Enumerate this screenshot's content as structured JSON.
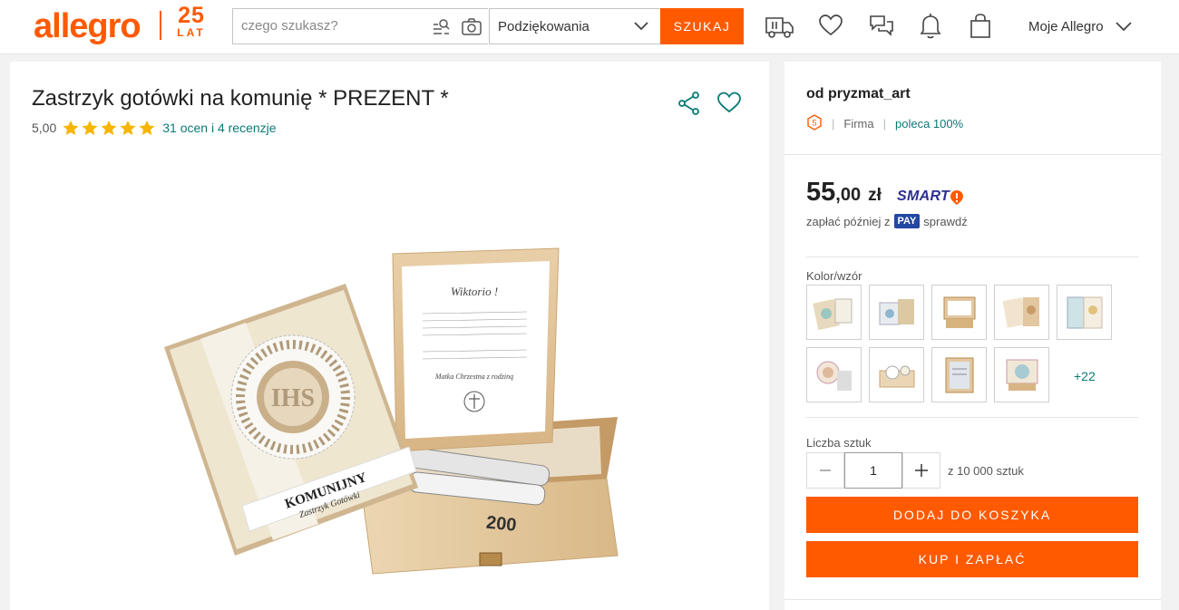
{
  "header": {
    "logo_text": "allegro",
    "anniversary_number": "25",
    "anniversary_word": "LAT",
    "search_placeholder": "czego szukasz?",
    "category": "Podziękowania",
    "search_button": "SZUKAJ",
    "account_label": "Moje Allegro",
    "icons": [
      "delivery-truck-icon",
      "heart-icon",
      "chat-icon",
      "bell-icon",
      "shopping-bag-icon"
    ]
  },
  "product": {
    "title": "Zastrzyk gotówki na komunię * PREZENT *",
    "rating_value": "5,00",
    "stars": 5,
    "rating_count": "31 ocen i 4 recenzje",
    "image_card_title": "Wiktorio !",
    "image_card_signature": "Matka Chrzestna z rodziną",
    "image_box_label": "KOMUNIJNY",
    "image_box_sublabel": "Zastrzyk Gotówki",
    "image_banknote": "200"
  },
  "seller": {
    "name": "od pryzmat_art",
    "type": "Firma",
    "recommend": "poleca 100%"
  },
  "offer": {
    "price_int": "55",
    "price_dec": ",00",
    "currency": "zł",
    "smart_label": "SMART",
    "paylater_prefix": "zapłać później z",
    "pay_badge": "PAY",
    "paylater_link": "sprawdź",
    "color_label": "Kolor/wzór",
    "more_variants": "+22",
    "qty_label": "Liczba sztuk",
    "qty_value": "1",
    "qty_available": "z 10 000 sztuk",
    "add_to_cart": "DODAJ DO KOSZYKA",
    "buy_now": "KUP I ZAPŁAĆ"
  },
  "colors": {
    "brand": "#ff5a00",
    "link": "#0b7a75",
    "star": "#f7b500",
    "smart": "#2d2f8f",
    "pay": "#2347a3"
  }
}
